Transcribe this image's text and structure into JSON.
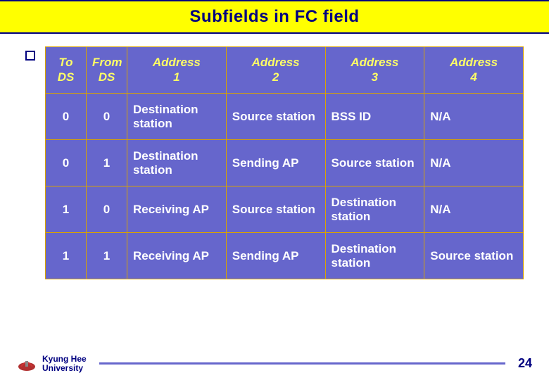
{
  "title": "Subfields in FC field",
  "table": {
    "headers": [
      "To\nDS",
      "From\nDS",
      "Address\n1",
      "Address\n2",
      "Address\n3",
      "Address\n4"
    ],
    "rows": [
      [
        "0",
        "0",
        "Destination station",
        "Source station",
        "BSS ID",
        "N/A"
      ],
      [
        "0",
        "1",
        "Destination station",
        "Sending AP",
        "Source station",
        "N/A"
      ],
      [
        "1",
        "0",
        "Receiving AP",
        "Source station",
        "Destination station",
        "N/A"
      ],
      [
        "1",
        "1",
        "Receiving AP",
        "Sending AP",
        "Destination station",
        "Source station"
      ]
    ]
  },
  "footer": {
    "university_line1": "Kyung Hee",
    "university_line2": "University",
    "page_number": "24"
  }
}
